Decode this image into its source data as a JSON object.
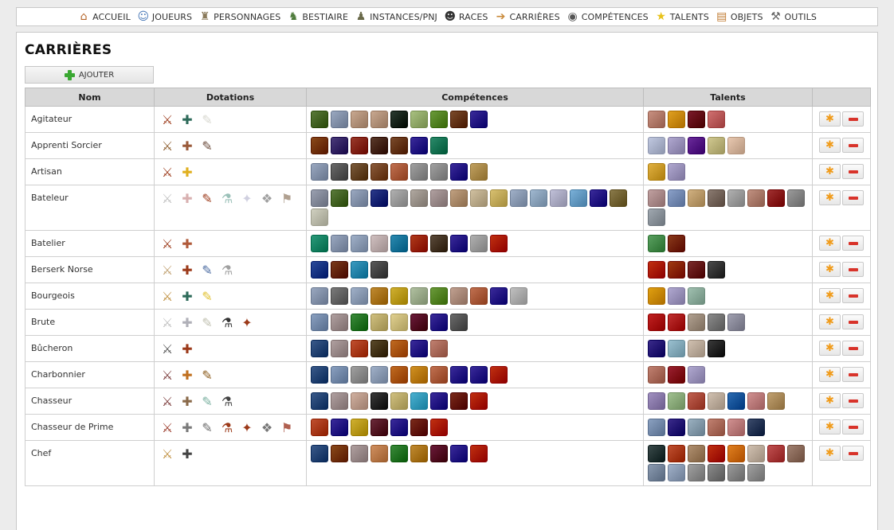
{
  "nav": [
    {
      "label": "ACCUEIL",
      "icon": "home-icon",
      "color": "#b5652a"
    },
    {
      "label": "JOUEURS",
      "icon": "user-icon",
      "color": "#4a79b8"
    },
    {
      "label": "PERSONNAGES",
      "icon": "character-icon",
      "color": "#8a7a5a"
    },
    {
      "label": "BESTIAIRE",
      "icon": "creature-icon",
      "color": "#4d7a3a"
    },
    {
      "label": "INSTANCES/PNJ",
      "icon": "npc-icon",
      "color": "#6a6a4a"
    },
    {
      "label": "RACES",
      "icon": "race-icon",
      "color": "#333333"
    },
    {
      "label": "CARRIÈRES",
      "icon": "signpost-icon",
      "color": "#c98a3a"
    },
    {
      "label": "COMPÉTENCES",
      "icon": "eye-icon",
      "color": "#555555"
    },
    {
      "label": "TALENTS",
      "icon": "star-icon",
      "color": "#e8c21a"
    },
    {
      "label": "OBJETS",
      "icon": "chest-icon",
      "color": "#c07a30"
    },
    {
      "label": "OUTILS",
      "icon": "hammer-icon",
      "color": "#666666"
    }
  ],
  "page": {
    "title": "CARRIÈRES",
    "add_label": "AJOUTER"
  },
  "table": {
    "headers": [
      "Nom",
      "Dotations",
      "Compétences",
      "Talents",
      ""
    ],
    "rows": [
      {
        "name": "Agitateur",
        "dotations": [
          "#9c3a1a",
          "#2e6b5a",
          "#d8d8d0"
        ],
        "competences": [
          "#5a7a3a",
          "#9aa8c0",
          "#c8a890",
          "#c8a890",
          "#2a3a30",
          "#a8c080",
          "#6a9a3a",
          "#7a4a2a",
          "#3a2a9a"
        ],
        "talents": [
          "#c89080",
          "#e0a020",
          "#7a1a2a",
          "#d07070"
        ]
      },
      {
        "name": "Apprenti Sorcier",
        "dotations": [
          "#8a5a2a",
          "#9a5a3a",
          "#6a4a3a"
        ],
        "competences": [
          "#8a4a1a",
          "#4a3a7a",
          "#9a3a2a",
          "#5a3a2a",
          "#7a4a2a",
          "#3a2a9a",
          "#2a8a6a"
        ],
        "talents": [
          "#c0c8e0",
          "#b0a8d0",
          "#6a2a9a",
          "#d0c890",
          "#e8c8b0"
        ]
      },
      {
        "name": "Artisan",
        "dotations": [
          "#9c3a1a",
          "#e0b020"
        ],
        "competences": [
          "#9aa8c0",
          "#6a6a6a",
          "#7a5a3a",
          "#8a5a3a",
          "#c07050",
          "#a0a0a0",
          "#a0a0a0",
          "#3a2a9a",
          "#c0a060"
        ],
        "talents": [
          "#e0b040",
          "#b0a8d0"
        ]
      },
      {
        "name": "Bateleur",
        "dotations": [
          "#c0c0c0",
          "#d8b0b0",
          "#9c3a1a",
          "#9ac0b8",
          "#d0d0e0",
          "#a0a0a0",
          "#b0a090"
        ],
        "competences": [
          "#9aa0b0",
          "#5a7a3a",
          "#9aa8c0",
          "#2a3a8a",
          "#b0b0b0",
          "#b0a8a0",
          "#b0a0a0",
          "#c0a080",
          "#d0c0a0",
          "#d8c070",
          "#a0b0c8",
          "#a0b8d0",
          "#c0c0d8",
          "#7ab0d8",
          "#3a2a9a",
          "#8a7a4a",
          "#d0d0c0"
        ],
        "talents": [
          "#c0a0a0",
          "#8aa0c8",
          "#d0b080",
          "#8a7a70",
          "#b0b0b0",
          "#c09080",
          "#a03030",
          "#9a9a9a",
          "#a0a8b0"
        ]
      },
      {
        "name": "Batelier",
        "dotations": [
          "#9c3a1a",
          "#b05a3a"
        ],
        "competences": [
          "#2a9a7a",
          "#9aa8c0",
          "#a0b0c8",
          "#d0c0c0",
          "#2a8ab0",
          "#b03a1a",
          "#5a4a3a",
          "#3a2a9a",
          "#b0b0b0",
          "#c03010"
        ],
        "talents": [
          "#5aa060",
          "#8a3a1a"
        ]
      },
      {
        "name": "Berserk Norse",
        "dotations": [
          "#c0a070",
          "#9c3a1a",
          "#4a6aa0",
          "#a0a0a0"
        ],
        "competences": [
          "#2a4a9a",
          "#7a3a1a",
          "#3a9ac0",
          "#5a5a5a"
        ],
        "talents": [
          "#c03010",
          "#a03a10",
          "#7a2a2a",
          "#4a4a4a"
        ]
      },
      {
        "name": "Bourgeois",
        "dotations": [
          "#c09040",
          "#2e6b5a",
          "#e0c030"
        ],
        "competences": [
          "#9aa8c0",
          "#7a7a7a",
          "#a0b0c8",
          "#c08a30",
          "#d0b030",
          "#b0c0a0",
          "#6a9a3a",
          "#c0a090",
          "#c07050",
          "#3a2a9a",
          "#c0c0c0"
        ],
        "talents": [
          "#e0a010",
          "#b0a8d0",
          "#a0c0b0"
        ]
      },
      {
        "name": "Brute",
        "dotations": [
          "#c0c0c0",
          "#b0b0b8",
          "#c0c0b0",
          "#333333",
          "#9c3a1a"
        ],
        "competences": [
          "#8aa0c0",
          "#b0a0a0",
          "#3a8a3a",
          "#d0c080",
          "#e0d090",
          "#6a1a3a",
          "#3a2a9a",
          "#6a6a6a"
        ],
        "talents": [
          "#c02020",
          "#c03030",
          "#b0a090",
          "#8a8a8a",
          "#a0a0b0"
        ]
      },
      {
        "name": "Bûcheron",
        "dotations": [
          "#555555",
          "#9c3a1a"
        ],
        "competences": [
          "#3a5a8a",
          "#b0a0a0",
          "#c05030",
          "#5a4a2a",
          "#c06a20",
          "#3a2a9a",
          "#c08070"
        ],
        "talents": [
          "#3a2a8a",
          "#9ac0d0",
          "#d0c0b0",
          "#3a3a3a"
        ]
      },
      {
        "name": "Charbonnier",
        "dotations": [
          "#7a3a3a",
          "#c07020",
          "#8a5a1a"
        ],
        "competences": [
          "#3a5a8a",
          "#8aa0c0",
          "#a0a0a0",
          "#a0b0c8",
          "#c06a20",
          "#d09020",
          "#c07050",
          "#3a2a9a",
          "#3a2a9a",
          "#c03010"
        ],
        "talents": [
          "#c08070",
          "#9a2030",
          "#b0a8d0"
        ]
      },
      {
        "name": "Chasseur",
        "dotations": [
          "#7a3a3a",
          "#8a6a4a",
          "#7ab0a0",
          "#444444"
        ],
        "competences": [
          "#3a5a8a",
          "#b0a0a0",
          "#d0b0a0",
          "#3a3a3a",
          "#d0c080",
          "#4ab0d0",
          "#3a2a9a",
          "#7a2a1a",
          "#c03010"
        ],
        "talents": [
          "#a090c0",
          "#a0c090",
          "#c06050",
          "#d0c0b0",
          "#2a6ab0",
          "#d09090",
          "#c0a070"
        ]
      },
      {
        "name": "Chasseur de Prime",
        "dotations": [
          "#9a3a2a",
          "#7a7a7a",
          "#6a6a6a",
          "#9c3a1a",
          "#9c3a1a",
          "#777777",
          "#b06050"
        ],
        "competences": [
          "#c05030",
          "#3a2a9a",
          "#d0b030",
          "#6a2a3a",
          "#3a2a9a",
          "#7a2a1a",
          "#c03010"
        ],
        "talents": [
          "#8aa0c0",
          "#3a2a8a",
          "#9ab0c0",
          "#c08070",
          "#d09090",
          "#3a4a6a"
        ]
      },
      {
        "name": "Chef",
        "dotations": [
          "#c09040",
          "#444444"
        ],
        "competences": [
          "#3a5a8a",
          "#8a4a1a",
          "#b0a0a0",
          "#d09060",
          "#3a8a3a",
          "#c08a30",
          "#6a1a3a",
          "#3a2a9a",
          "#c03010"
        ],
        "talents": [
          "#3a4a4a",
          "#c05030",
          "#b09070",
          "#c03010",
          "#e08020",
          "#d0c0b0",
          "#c05050",
          "#a08070",
          "#8a9ab0",
          "#a0b0c8",
          "#a0a0a0",
          "#8a8a8a",
          "#9a9a9a",
          "#a0a0a0"
        ]
      }
    ]
  }
}
